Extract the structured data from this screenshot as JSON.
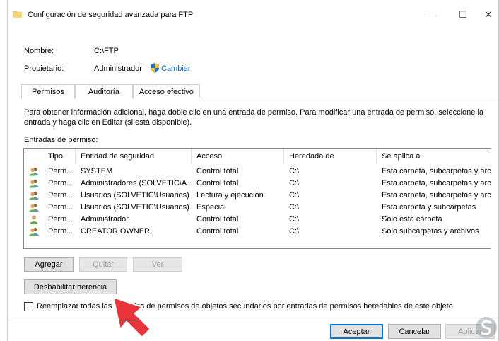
{
  "window": {
    "title": "Configuración de seguridad avanzada para FTP",
    "minimize_glyph": "—",
    "maximize_glyph": "☐",
    "close_glyph": "✕"
  },
  "fields": {
    "name_label": "Nombre:",
    "name_value": "C:\\FTP",
    "owner_label": "Propietario:",
    "owner_value": "Administrador",
    "change_link": "Cambiar"
  },
  "tabs": [
    {
      "label": "Permisos",
      "active": true
    },
    {
      "label": "Auditoría",
      "active": false
    },
    {
      "label": "Acceso efectivo",
      "active": false
    }
  ],
  "info_text": "Para obtener información adicional, haga doble clic en una entrada de permiso. Para modificar una entrada de permiso, seleccione la entrada y haga clic en Editar (si está disponible).",
  "entries_label": "Entradas de permiso:",
  "table": {
    "headers": [
      "Tipo",
      "Entidad de seguridad",
      "Acceso",
      "Heredada de",
      "Se aplica a"
    ],
    "rows": [
      {
        "icon": "group-icon",
        "tipo": "Perm...",
        "entidad": "SYSTEM",
        "acceso": "Control total",
        "heredada": "C:\\",
        "aplica": "Esta carpeta, subcarpetas y arc..."
      },
      {
        "icon": "group-icon",
        "tipo": "Perm...",
        "entidad": "Administradores (SOLVETIC\\A...",
        "acceso": "Control total",
        "heredada": "C:\\",
        "aplica": "Esta carpeta, subcarpetas y arc..."
      },
      {
        "icon": "group-icon",
        "tipo": "Perm...",
        "entidad": "Usuarios (SOLVETIC\\Usuarios)",
        "acceso": "Lectura y ejecución",
        "heredada": "C:\\",
        "aplica": "Esta carpeta, subcarpetas y arc..."
      },
      {
        "icon": "group-icon",
        "tipo": "Perm...",
        "entidad": "Usuarios (SOLVETIC\\Usuarios)",
        "acceso": "Especial",
        "heredada": "C:\\",
        "aplica": "Esta carpeta y subcarpetas"
      },
      {
        "icon": "user-icon",
        "tipo": "Perm...",
        "entidad": "Administrador",
        "acceso": "Control total",
        "heredada": "C:\\",
        "aplica": "Solo esta carpeta"
      },
      {
        "icon": "group-icon",
        "tipo": "Perm...",
        "entidad": "CREATOR OWNER",
        "acceso": "Control total",
        "heredada": "C:\\",
        "aplica": "Solo subcarpetas y archivos"
      }
    ]
  },
  "buttons": {
    "add": "Agregar",
    "remove": "Quitar",
    "view": "Ver",
    "disable_inheritance": "Deshabilitar herencia",
    "accept": "Aceptar",
    "cancel": "Cancelar",
    "apply": "Aplicar"
  },
  "checkbox": {
    "label": "Reemplazar todas las entradas de permisos de objetos secundarios por entradas de permisos heredables de este objeto",
    "checked": false
  },
  "colors": {
    "accent": "#0078d7",
    "link": "#0b63c5",
    "cursor_arrow": "#e8343a"
  }
}
